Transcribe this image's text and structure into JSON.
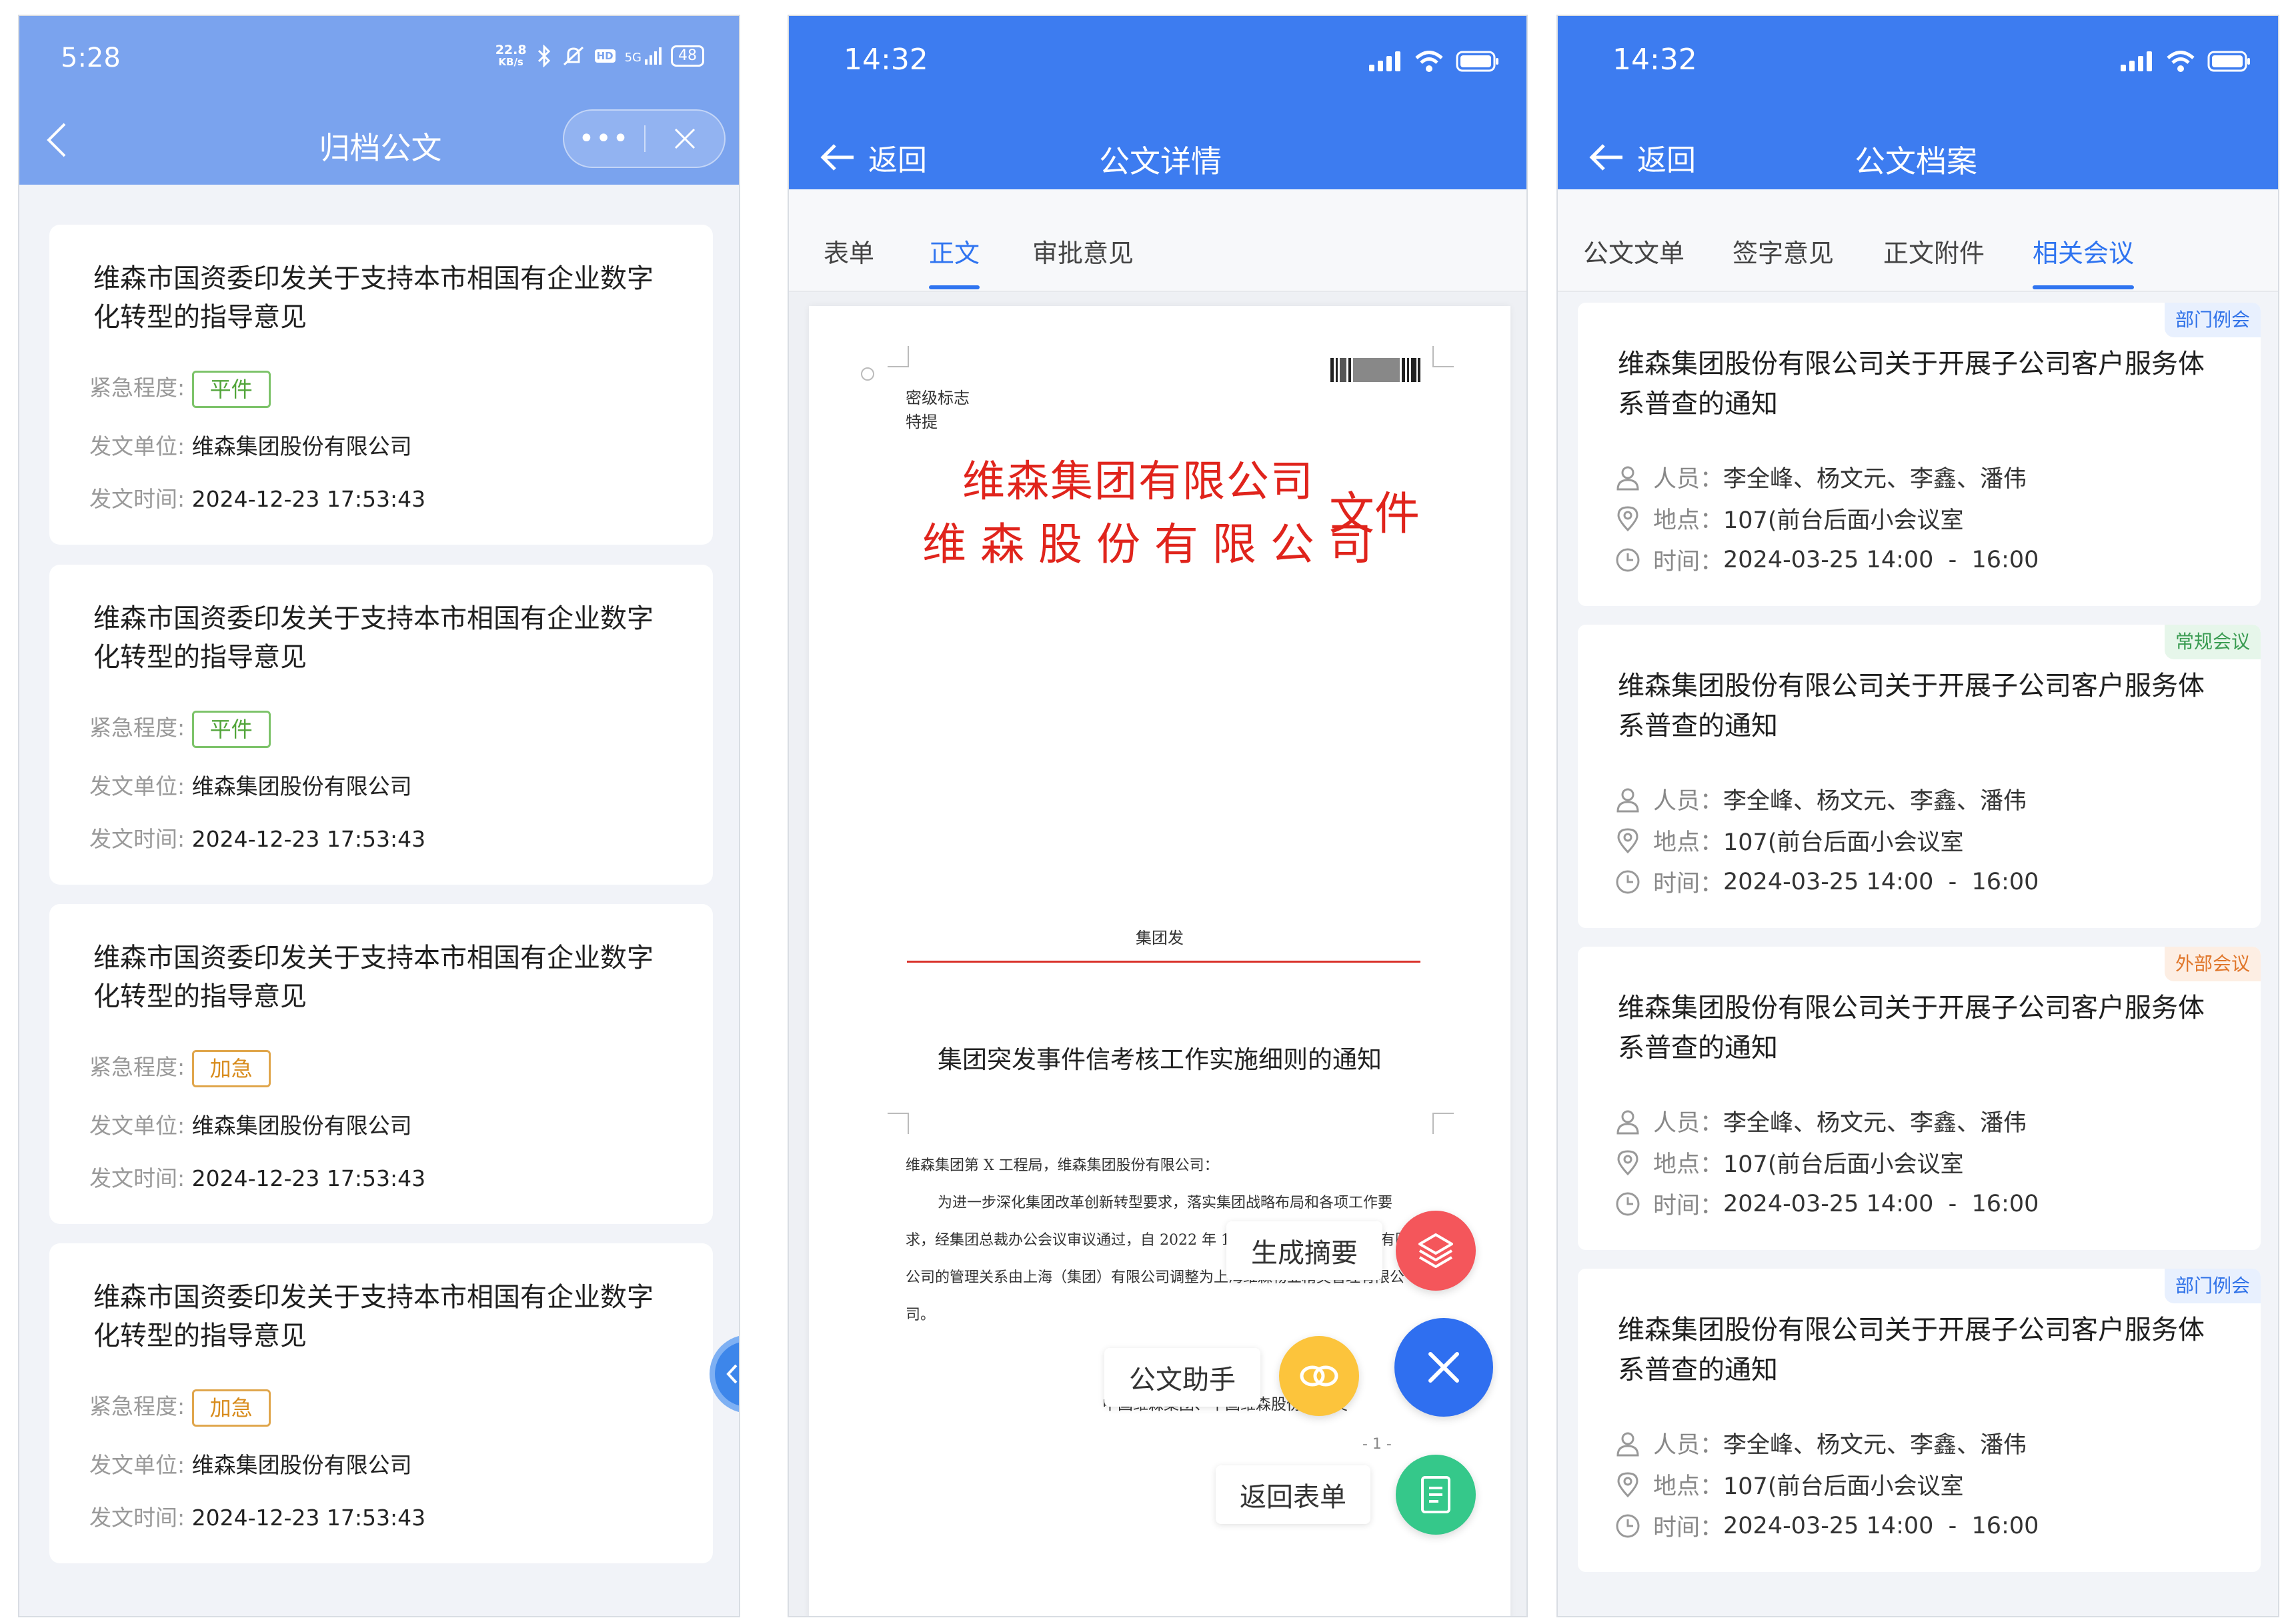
{
  "phone1": {
    "status": {
      "time": "5:28",
      "net_speed_top": "22.8",
      "net_speed_unit": "KB/s",
      "signal": "5G",
      "hd": "HD",
      "battery": "48"
    },
    "header": {
      "title": "归档公文"
    },
    "cards": [
      {
        "title": "维森市国资委印发关于支持本市相国有企业数字化转型的指导意见",
        "urgency_label": "紧急程度:",
        "urgency": "平件",
        "urgency_type": "normal",
        "org_label": "发文单位:",
        "org": "维森集团股份有限公司",
        "time_label": "发文时间:",
        "time": "2024-12-23 17:53:43"
      },
      {
        "title": "维森市国资委印发关于支持本市相国有企业数字化转型的指导意见",
        "urgency_label": "紧急程度:",
        "urgency": "平件",
        "urgency_type": "normal",
        "org_label": "发文单位:",
        "org": "维森集团股份有限公司",
        "time_label": "发文时间:",
        "time": "2024-12-23 17:53:43"
      },
      {
        "title": "维森市国资委印发关于支持本市相国有企业数字化转型的指导意见",
        "urgency_label": "紧急程度:",
        "urgency": "加急",
        "urgency_type": "urgent",
        "org_label": "发文单位:",
        "org": "维森集团股份有限公司",
        "time_label": "发文时间:",
        "time": "2024-12-23 17:53:43"
      },
      {
        "title": "维森市国资委印发关于支持本市相国有企业数字化转型的指导意见",
        "urgency_label": "紧急程度:",
        "urgency": "加急",
        "urgency_type": "urgent",
        "org_label": "发文单位:",
        "org": "维森集团股份有限公司",
        "time_label": "发文时间:",
        "time": "2024-12-23 17:53:43"
      }
    ]
  },
  "phone2": {
    "status": {
      "time": "14:32"
    },
    "header": {
      "back": "返回",
      "title": "公文详情"
    },
    "tabs": [
      "表单",
      "正文",
      "审批意见"
    ],
    "active_tab": "正文",
    "doc": {
      "secret_label": "密级标志",
      "urgency": "特提",
      "company1": "维森集团有限公司",
      "company2": "维 森 股 份 有 限 公 司",
      "file_word": "文件",
      "issuer": "集团发",
      "heading": "集团突发事件信考核工作实施细则的通知",
      "addressee": "维森集团第 X 工程局，维森集团股份有限公司：",
      "body": "为进一步深化集团改革创新转型要求，落实集团战略布局和各项工作要求，经集团总裁办公会议审议通过，自 2022 年 11 月 1 日起，上海维森有限公司的管理关系由上海（集团）有限公司调整为上海维森物业精英管理有限公司。",
      "signature": "中国维森集团、中国维森股份联合发",
      "page_no": "- 1 -"
    },
    "fab": {
      "summary": "生成摘要",
      "assistant": "公文助手",
      "back_form": "返回表单"
    },
    "colors": {
      "summary": "#f4565b",
      "assistant": "#fcc43c",
      "close": "#2f6ff0",
      "form": "#35c88a"
    }
  },
  "phone3": {
    "status": {
      "time": "14:32"
    },
    "header": {
      "back": "返回",
      "title": "公文档案"
    },
    "tabs": [
      "公文文单",
      "签字意见",
      "正文附件",
      "相关会议"
    ],
    "active_tab": "相关会议",
    "meetings": [
      {
        "tag": "部门例会",
        "tag_type": "blue",
        "title": "维森集团股份有限公司关于开展子公司客户服务体系普查的通知",
        "people_label": "人员：",
        "people": "李全峰、杨文元、李鑫、潘伟",
        "place_label": "地点：",
        "place": "107(前台后面小会议室",
        "time_label": "时间：",
        "time": "2024-03-25 14:00  -  16:00"
      },
      {
        "tag": "常规会议",
        "tag_type": "green",
        "title": "维森集团股份有限公司关于开展子公司客户服务体系普查的通知",
        "people_label": "人员：",
        "people": "李全峰、杨文元、李鑫、潘伟",
        "place_label": "地点：",
        "place": "107(前台后面小会议室",
        "time_label": "时间：",
        "time": "2024-03-25 14:00  -  16:00"
      },
      {
        "tag": "外部会议",
        "tag_type": "orange",
        "title": "维森集团股份有限公司关于开展子公司客户服务体系普查的通知",
        "people_label": "人员：",
        "people": "李全峰、杨文元、李鑫、潘伟",
        "place_label": "地点：",
        "place": "107(前台后面小会议室",
        "time_label": "时间：",
        "time": "2024-03-25 14:00  -  16:00"
      },
      {
        "tag": "部门例会",
        "tag_type": "blue",
        "title": "维森集团股份有限公司关于开展子公司客户服务体系普查的通知",
        "people_label": "人员：",
        "people": "李全峰、杨文元、李鑫、潘伟",
        "place_label": "地点：",
        "place": "107(前台后面小会议室",
        "time_label": "时间：",
        "time": "2024-03-25 14:00  -  16:00"
      }
    ]
  }
}
